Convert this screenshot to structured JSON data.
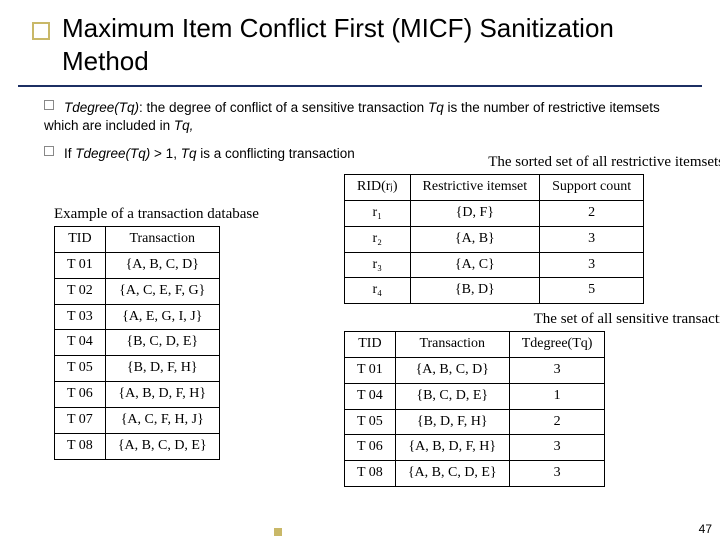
{
  "title": "Maximum Item Conflict First (MICF) Sanitization Method",
  "para1": {
    "lead": "Tdegree(Tq)",
    "rest1": ": the degree of conflict of a sensitive transaction ",
    "tq": "Tq",
    "rest2": " is the number of restrictive itemsets which are included in ",
    "tq2": "Tq,"
  },
  "para2": {
    "a": "If ",
    "b": "Tdegree(Tq)",
    "c": " > 1, ",
    "d": "Tq",
    "e": " is a conflicting transaction"
  },
  "db": {
    "caption": "Example of a transaction database",
    "headers": [
      "TID",
      "Transaction"
    ],
    "rows": [
      [
        "T 01",
        "{A, B, C, D}"
      ],
      [
        "T 02",
        "{A, C, E, F, G}"
      ],
      [
        "T 03",
        "{A, E, G, I, J}"
      ],
      [
        "T 04",
        "{B, C, D, E}"
      ],
      [
        "T 05",
        "{B, D, F, H}"
      ],
      [
        "T 06",
        "{A, B, D, F, H}"
      ],
      [
        "T 07",
        "{A, C, F, H, J}"
      ],
      [
        "T 08",
        "{A, B, C, D, E}"
      ]
    ]
  },
  "rid": {
    "caption": "The sorted set of all restrictive itemsets",
    "headers": [
      "RID(rⱼ)",
      "Restrictive itemset",
      "Support count"
    ],
    "rows": [
      [
        "r₁",
        "{D, F}",
        "2"
      ],
      [
        "r₂",
        "{A, B}",
        "3"
      ],
      [
        "r₃",
        "{A, C}",
        "3"
      ],
      [
        "r₄",
        "{B, D}",
        "5"
      ]
    ]
  },
  "sens": {
    "caption": "The set of all sensitive transactions",
    "headers": [
      "TID",
      "Transaction",
      "Tdegree(Tq)"
    ],
    "rows": [
      [
        "T 01",
        "{A, B, C, D}",
        "3"
      ],
      [
        "T 04",
        "{B, C, D, E}",
        "1"
      ],
      [
        "T 05",
        "{B, D, F, H}",
        "2"
      ],
      [
        "T 06",
        "{A, B, D, F, H}",
        "3"
      ],
      [
        "T 08",
        "{A, B, C, D, E}",
        "3"
      ]
    ]
  },
  "pagenum": "47"
}
